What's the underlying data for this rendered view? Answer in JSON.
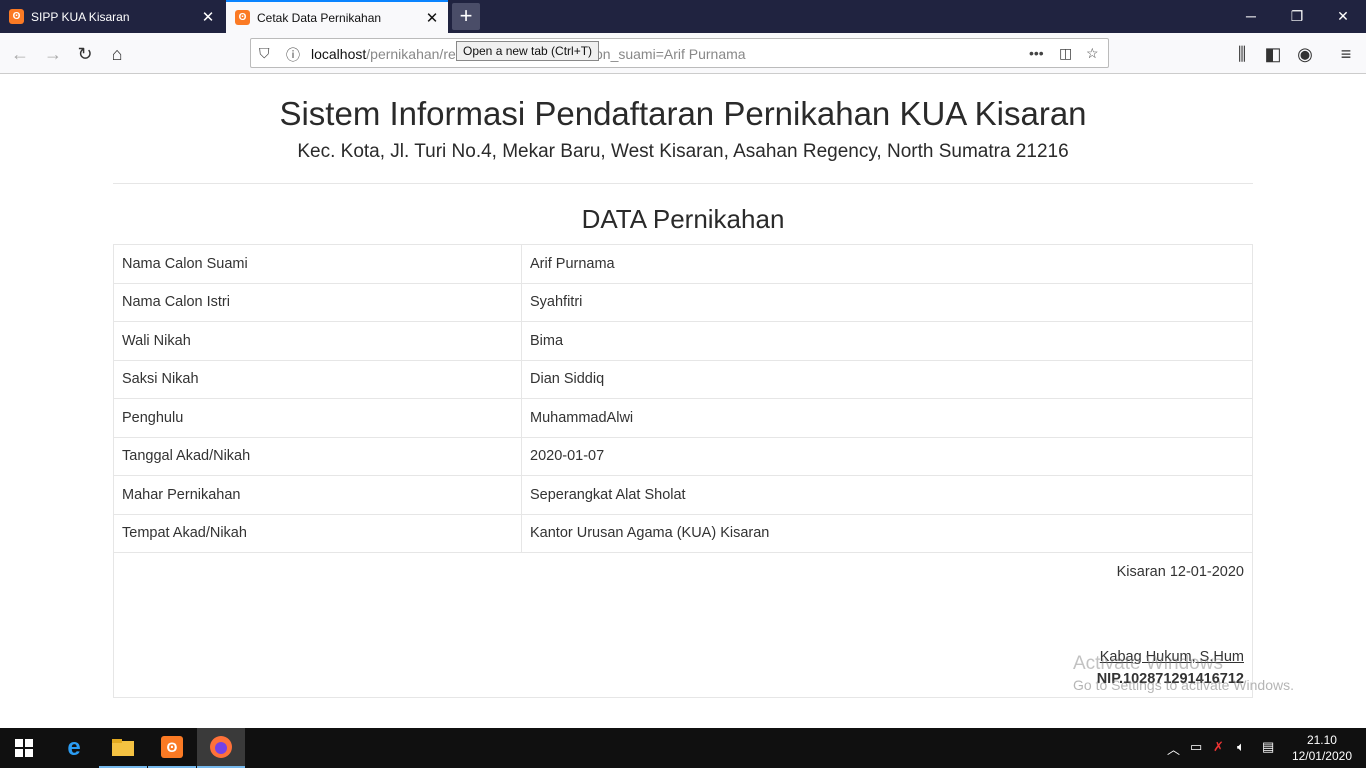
{
  "browser": {
    "tabs": [
      {
        "title": "SIPP KUA Kisaran"
      },
      {
        "title": "Cetak Data Pernikahan"
      }
    ],
    "tooltip": "Open a new tab (Ctrl+T)",
    "url_host": "localhost",
    "url_path_prefix": "/pernikahan/re",
    "url_path_suffix": "on_suami=Arif Purnama",
    "window_buttons": {
      "minimize": "─",
      "restore": "❐",
      "close": "✕"
    }
  },
  "page": {
    "title": "Sistem Informasi Pendaftaran Pernikahan KUA Kisaran",
    "address": "Kec. Kota, Jl. Turi No.4, Mekar Baru, West Kisaran, Asahan Regency, North Sumatra 21216",
    "section_title": "DATA Pernikahan",
    "rows": [
      {
        "label": "Nama Calon Suami",
        "value": "Arif Purnama"
      },
      {
        "label": "Nama Calon Istri",
        "value": "Syahfitri"
      },
      {
        "label": "Wali Nikah",
        "value": "Bima"
      },
      {
        "label": "Saksi Nikah",
        "value": "Dian Siddiq"
      },
      {
        "label": "Penghulu",
        "value": "MuhammadAlwi"
      },
      {
        "label": "Tanggal Akad/Nikah",
        "value": "2020-01-07"
      },
      {
        "label": "Mahar Pernikahan",
        "value": "Seperangkat Alat Sholat"
      },
      {
        "label": "Tempat Akad/Nikah",
        "value": "Kantor Urusan Agama (KUA) Kisaran"
      }
    ],
    "place_date": "Kisaran 12-01-2020",
    "signer": "Kabag Hukum, S.Hum",
    "nip": "NIP.102871291416712"
  },
  "watermark": {
    "line1": "Activate Windows",
    "line2": "Go to Settings to activate Windows."
  },
  "taskbar": {
    "time": "21.10",
    "date": "12/01/2020"
  }
}
